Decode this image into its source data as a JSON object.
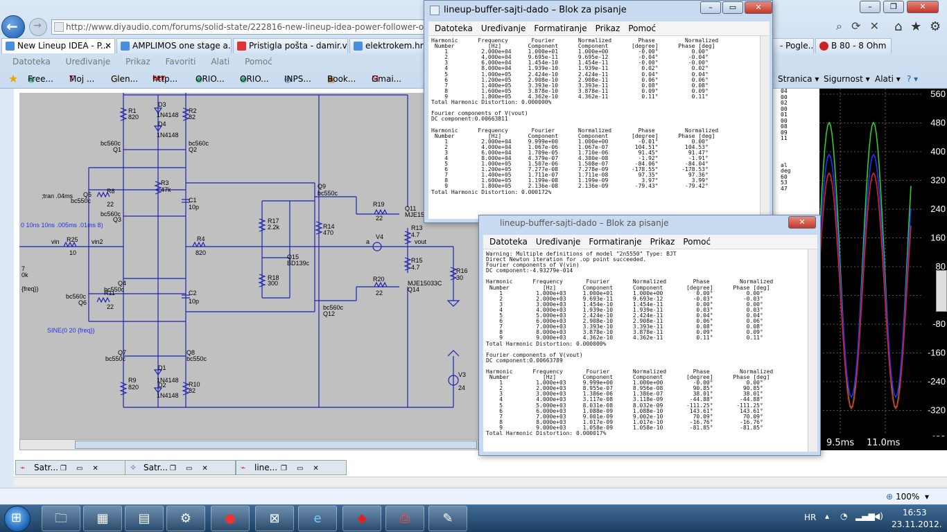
{
  "browser": {
    "address": "http://www.diyaudio.com/forums/solid-state/222816-new-lineup-idea-power-follower-output-st...",
    "tabs": [
      "New Lineup IDEA - P...",
      "AMPLIMOS one stage a...",
      "Pristigla pošta - damir.v...",
      "elektrokem.hr",
      "- Pogle...",
      "B 80 - 8 Ohm"
    ],
    "menu": [
      "Datoteka",
      "Uređivanje",
      "Prikaz",
      "Favoriti",
      "Alati",
      "Pomoć"
    ],
    "favorites": [
      "Free...",
      "Moj ...",
      "Glen...",
      "http...",
      "ORIO...",
      "ORIO...",
      "INPS...",
      "Book...",
      "Gmai..."
    ],
    "command_bar": [
      "Stranica ▾",
      "Sigurnost ▾",
      "Alati ▾",
      "? ▾"
    ],
    "zoom": "100%"
  },
  "ltspice": {
    "mdi_tabs": [
      "Satr...",
      "Satr...",
      "line..."
    ],
    "labels": {
      "R1": "R1",
      "R1v": "820",
      "R2": "R2",
      "R2v": "82",
      "D3": "D3",
      "D3v": "1N4148",
      "D4": "D4",
      "D4v": "1N4148",
      "Q1t": "bc560c",
      "Q1": "Q1",
      "Q2t": "bc560c",
      "Q2": "Q2",
      "R3": "R3",
      "R3v": "47k",
      "C1": "C1",
      "C1v": "10p",
      "Q9": "Q9",
      "Q9t": "bc550c",
      "tran": ";tran .04ms",
      "Q5": "Q5",
      "Q5t": "bc550c",
      "R8": "R8",
      "R8v": "22",
      "Q3t": "bc560c",
      "Q3": "Q3",
      "R17": "R17",
      "R17v": "2.2k",
      "R14": "R14",
      "R14v": "470",
      "R19": "R19",
      "R19v": "22",
      "Q11": "Q11",
      "Q11t": "MJE15",
      "R13": "R13",
      "R13v": "4.7",
      "pulse": "0 10ns 10ns .005ms .01ms 8)",
      "vin": "vin",
      "R25": "R25",
      "R25v": "10",
      "vin2": "vin2",
      "R4": "R4",
      "R4v": "820",
      "V4": "V4",
      "a": "a",
      "vout": "vout",
      "Q15": "Q15",
      "Q15t": "BD139c",
      "R15": "R15",
      "R15v": "4.7",
      "R16": "R16",
      "R16v": "30",
      "R18": "R18",
      "R18v": "300",
      "Q4": "Q4",
      "Q4t": "bc550c",
      "Q6t": "bc560c",
      "Q6": "Q6",
      "R11": "R11",
      "R11v": "22",
      "C2": "C2",
      "C2v": "10p",
      "R20": "R20",
      "R20v": "22",
      "Q14t": "MJE15033C",
      "Q14": "Q14",
      "Q12t": "bc560c",
      "Q12": "Q12",
      "sine": "SINE(0 20 {freq})",
      "freq": "{freq})",
      "k0": "0k",
      "n7": "7",
      "Q7": "Q7",
      "Q7t": "bc550c",
      "Q8": "Q8",
      "Q8t": "bc550c",
      "D1": "D1",
      "D1v": "1N4148",
      "D2": "D2",
      "D2v": "1N4148",
      "R9": "R9",
      "R9v": "820",
      "R10": "R10",
      "R10v": "82",
      "V3": "V3",
      "V3v": "24"
    },
    "graph": {
      "yticks": [
        "560",
        "480",
        "400",
        "320",
        "240",
        "160",
        "80",
        "0",
        "-80",
        "-160",
        "-240",
        "-320",
        "-400"
      ],
      "xticks": [
        "9.5ms",
        "11.0ms"
      ],
      "colors": {
        "green": "#2bd32b",
        "blue": "#2030ff",
        "red": "#e02020"
      }
    },
    "side_text": [
      "04",
      "00",
      "02",
      "00",
      "01",
      "00",
      "08",
      "09",
      "11",
      "al",
      "deg",
      "60",
      "53",
      "47"
    ]
  },
  "notepad1": {
    "title": "lineup-buffer-sajti-dado – Blok za pisanje",
    "menu": [
      "Datoteka",
      "Uređivanje",
      "Formatiranje",
      "Prikaz",
      "Pomoć"
    ],
    "text": "Harmonic      Frequency       Fourier       Normalized        Phase         Normalized\n Number          [Hz]        Component      Component       [degree]      Phase [deg]\n    1          2.000e+04     1.000e+01      1.000e+00         -0.00°          0.00°\n    2          4.000e+04     9.695e-11      9.695e-12         -0.04°         -0.04°\n    3          6.000e+04     1.454e-10      1.454e-11         -0.00°         -0.00°\n    4          8.000e+04     1.939e-10      1.939e-11          0.02°          0.02°\n    5          1.000e+05     2.424e-10      2.424e-11          0.04°          0.04°\n    6          1.200e+05     2.908e-10      2.908e-11          0.06°          0.06°\n    7          1.400e+05     3.393e-10      3.393e-11          0.08°          0.08°\n    8          1.600e+05     3.878e-10      3.878e-11          0.09°          0.09°\n    9          1.800e+05     4.362e-10      4.362e-11          0.11°          0.11°\nTotal Harmonic Distortion: 0.000000%\n\nFourier components of V(vout)\nDC component:0.00663811\n\nHarmonic      Frequency       Fourier       Normalized        Phase         Normalized\n Number          [Hz]        Component      Component       [degree]      Phase [deg]\n    1          2.000e+04     9.999e+00      1.000e+00         -0.01°          0.00°\n    2          4.000e+04     1.067e-06      1.067e-07        104.51°        104.53°\n    3          6.000e+04     1.709e-05      1.710e-06         91.45°         91.47°\n    4          8.000e+04     4.379e-07      4.380e-08         -1.92°         -1.91°\n    5          1.000e+05     1.507e-06      1.508e-07        -84.06°        -84.04°\n    6          1.200e+05     7.277e-08      7.278e-09       -178.55°       -178.53°\n    7          1.400e+05     1.711e-07      1.711e-08         97.35°         97.36°\n    8          1.600e+05     1.199e-08      1.199e-09          3.97°          3.99°\n    9          1.800e+05     2.136e-08      2.136e-09        -79.43°        -79.42°\nTotal Harmonic Distortion: 0.000172%"
  },
  "notepad2": {
    "title": "lineup-buffer-sajti-dado – Blok za pisanje",
    "menu": [
      "Datoteka",
      "Uređivanje",
      "Formatiranje",
      "Prikaz",
      "Pomoć"
    ],
    "text": "Warning: Multiple definitions of model \"2n5550\" Type: BJT\nDirect Newton iteration for .op point succeeded.\nFourier components of V(vin)\nDC component:-4.93279e-014\n\nHarmonic      Frequency       Fourier       Normalized        Phase         Normalized\n Number          [Hz]        Component      Component       [degree]      Phase [deg]\n    1          1.000e+03     1.000e+01      1.000e+00          0.00°          0.00°\n    2          2.000e+03     9.693e-11      9.693e-12         -0.03°         -0.03°\n    3          3.000e+03     1.454e-10      1.454e-11          0.00°          0.00°\n    4          4.000e+03     1.939e-10      1.939e-11          0.03°          0.03°\n    5          5.000e+03     2.424e-10      2.424e-11          0.04°          0.04°\n    6          6.000e+03     2.908e-10      2.908e-11          0.06°          0.06°\n    7          7.000e+03     3.393e-10      3.393e-11          0.08°          0.08°\n    8          8.000e+03     3.878e-10      3.878e-11          0.09°          0.09°\n    9          9.000e+03     4.362e-10      4.362e-11          0.11°          0.11°\nTotal Harmonic Distortion: 0.000000%\n\nFourier components of V(vout)\nDC component:0.00663789\n\nHarmonic      Frequency       Fourier       Normalized        Phase         Normalized\n Number          [Hz]        Component      Component       [degree]      Phase [deg]\n    1          1.000e+03     9.999e+00      1.000e+00         -0.00°          0.00°\n    2          2.000e+03     8.955e-07      8.956e-08         90.85°         90.85°\n    3          3.000e+03     1.386e-06      1.386e-07         38.01°         38.01°\n    4          4.000e+03     3.117e-08      3.118e-09        -44.88°        -44.88°\n    5          5.000e+03     8.031e-08      8.032e-09       -111.25°       -111.25°\n    6          6.000e+03     1.088e-09      1.088e-10        143.61°        143.61°\n    7          7.000e+03     9.001e-09      9.002e-10         70.09°         70.09°\n    8          8.000e+03     1.017e-09      1.017e-10        -16.76°        -16.76°\n    9          9.000e+03     1.058e-09      1.058e-10        -81.85°        -81.85°\nTotal Harmonic Distortion: 0.000017%"
  },
  "tray": {
    "lang": "HR",
    "time": "16:53",
    "date": "23.11.2012."
  }
}
